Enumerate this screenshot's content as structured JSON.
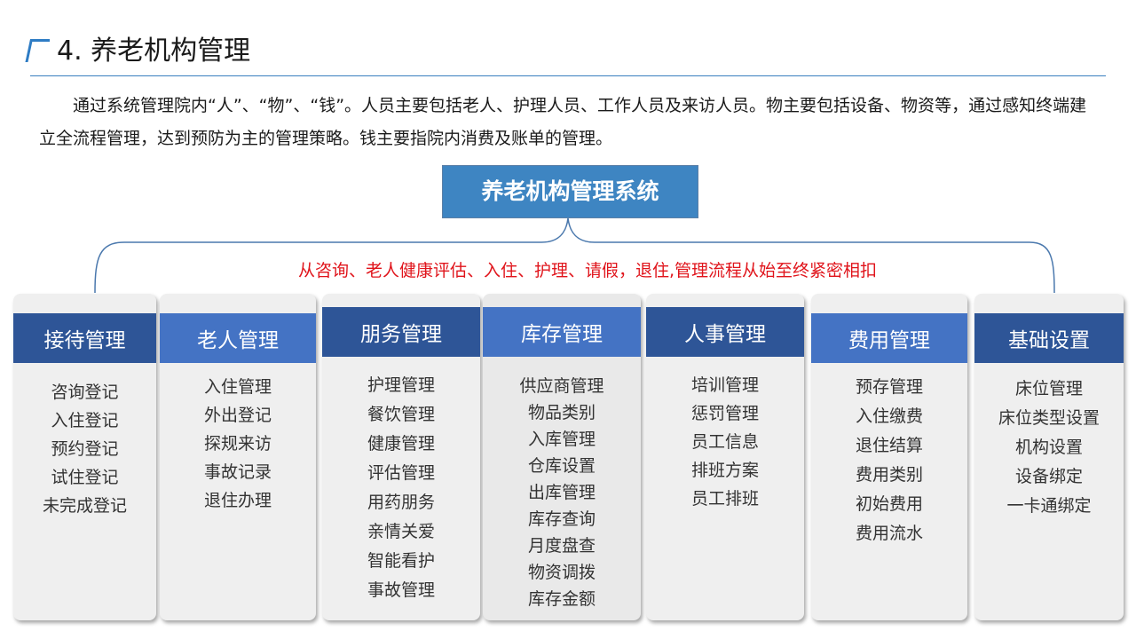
{
  "header": {
    "title": "4. 养老机构管理"
  },
  "intro": {
    "text": "通过系统管理院内“人”、“物”、“钱”。人员主要包括老人、护理人员、工作人员及来访人员。物主要包括设备、物资等，通过感知终端建立全流程管理，达到预防为主的管理策略。钱主要指院内消费及账单的管理。"
  },
  "diagram": {
    "root": "养老机构管理系统",
    "flow_note": "从咨询、老人健康评估、入住、护理、请假，退住,管理流程从始至终紧密相扣",
    "colors": {
      "header_dark": "#2e5597",
      "header_light": "#4473c4",
      "root": "#3e85c2",
      "note": "#e0141b",
      "panel": "#efefef"
    },
    "panels": [
      {
        "title": "接待管理",
        "items": [
          "咨询登记",
          "入住登记",
          "预约登记",
          "试住登记",
          "未完成登记"
        ]
      },
      {
        "title": "老人管理",
        "items": [
          "入住管理",
          "外出登记",
          "探规来访",
          "事故记录",
          "退住办理"
        ]
      },
      {
        "title": "朋务管理",
        "items": [
          "护理管理",
          "餐饮管理",
          "健康管理",
          "评估管理",
          "用药朋务",
          "亲情关爱",
          "智能看护",
          "事故管理"
        ]
      },
      {
        "title": "库存管理",
        "items": [
          "供应商管理",
          "物品类别",
          "入库管理",
          "仓库设置",
          "出库管理",
          "库存查询",
          "月度盘查",
          "物资调拨",
          "库存金额"
        ]
      },
      {
        "title": "人事管理",
        "items": [
          "培训管理",
          "惩罚管理",
          "员工信息",
          "排班方案",
          "员工排班"
        ]
      },
      {
        "title": "费用管理",
        "items": [
          "预存管理",
          "入住缴费",
          "退住结算",
          "费用类别",
          "初始费用",
          "费用流水"
        ]
      },
      {
        "title": "基础设置",
        "items": [
          "床位管理",
          "床位类型设置",
          "机构设置",
          "设备绑定",
          "一卡通绑定"
        ]
      }
    ]
  }
}
